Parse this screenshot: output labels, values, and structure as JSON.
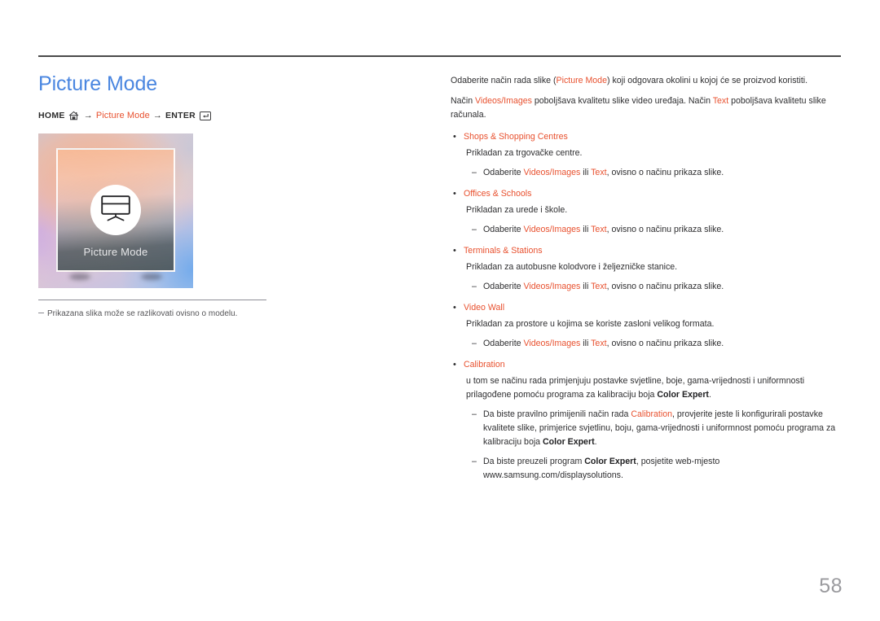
{
  "page": {
    "title": "Picture Mode",
    "number": "58"
  },
  "breadcrumb": {
    "home_label": "HOME",
    "home_icon": "home-icon",
    "arrow": "→",
    "middle_label": "Picture Mode",
    "enter_label": "ENTER",
    "enter_icon": "enter-key-icon"
  },
  "thumbnail": {
    "icon": "monitor-icon",
    "label": "Picture Mode"
  },
  "note": {
    "text": "Prikazana slika može se razlikovati ovisno o modelu."
  },
  "content": {
    "intro": {
      "line1_a": "Odaberite način rada slike (",
      "line1_accent": "Picture Mode",
      "line1_b": ") koji odgovara okolini u kojoj će se proizvod koristiti.",
      "line2_a": "Način ",
      "line2_accent1": "Videos/Images",
      "line2_b": " poboljšava kvalitetu slike video uređaja. Način ",
      "line2_accent2": "Text",
      "line2_c": " poboljšava kvalitetu slike računala."
    },
    "common": {
      "dash": "–",
      "bullet": "•",
      "choose_a": "Odaberite ",
      "choose_accent1": "Videos/Images",
      "choose_b": " ili ",
      "choose_accent2": "Text",
      "choose_c": ", ovisno o načinu prikaza slike."
    },
    "sections": [
      {
        "heading": "Shops & Shopping Centres",
        "description": "Prikladan za trgovačke centre."
      },
      {
        "heading": "Offices & Schools",
        "description": "Prikladan za urede i škole."
      },
      {
        "heading": "Terminals & Stations",
        "description": "Prikladan za autobusne kolodvore i željezničke stanice."
      },
      {
        "heading": "Video Wall",
        "description": "Prikladan za prostore u kojima se koriste zasloni velikog formata."
      }
    ],
    "calibration": {
      "heading": "Calibration",
      "desc_a": "u tom se načinu rada primjenjuju postavke svjetline, boje, gama-vrijednosti i uniformnosti prilagođene pomoću programa za kalibraciju boja ",
      "desc_bold": "Color Expert",
      "desc_b": ".",
      "note1_a": "Da biste pravilno primijenili način rada ",
      "note1_accent": "Calibration",
      "note1_b": ", provjerite jeste li konfigurirali postavke kvalitete slike, primjerice svjetlinu, boju, gama-vrijednosti i uniformnost pomoću programa za kalibraciju boja ",
      "note1_bold": "Color Expert",
      "note1_c": ".",
      "note2_a": "Da biste preuzeli program ",
      "note2_bold": "Color Expert",
      "note2_b": ", posjetite web-mjesto www.samsung.com/displaysolutions."
    }
  },
  "colors": {
    "title_blue": "#4a86e0",
    "accent_orange": "#e8512f",
    "body_text": "#2e2e30",
    "page_number": "#9a9a9e"
  }
}
